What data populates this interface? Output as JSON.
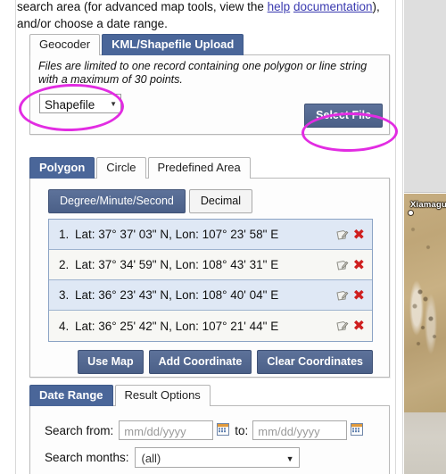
{
  "intro": {
    "line1_pre": "search area (for advanced map tools, view the ",
    "help_link": "help",
    "doc_link": "documentation",
    "line2_post": "), and/or choose a date range."
  },
  "upload_section": {
    "tabs": [
      {
        "label": "Geocoder",
        "active": false
      },
      {
        "label": "KML/Shapefile Upload",
        "active": true
      }
    ],
    "note": "Files are limited to one record containing one polygon or line string with a maximum of 30 points.",
    "file_type_value": "Shapefile",
    "file_type_caret": "▼",
    "select_file_label": "Select File"
  },
  "area_section": {
    "tabs": [
      {
        "label": "Polygon",
        "active": true
      },
      {
        "label": "Circle",
        "active": false
      },
      {
        "label": "Predefined Area",
        "active": false
      }
    ],
    "unit_toggle": [
      {
        "label": "Degree/Minute/Second",
        "active": true
      },
      {
        "label": "Decimal",
        "active": false
      }
    ],
    "coordinates": [
      {
        "num": "1.",
        "text": "Lat: 37° 37' 03\" N, Lon: 107° 23' 58\" E"
      },
      {
        "num": "2.",
        "text": "Lat: 37° 34' 59\" N, Lon: 108° 43' 31\" E"
      },
      {
        "num": "3.",
        "text": "Lat: 36° 23' 43\" N, Lon: 108° 40' 04\" E"
      },
      {
        "num": "4.",
        "text": "Lat: 36° 25' 42\" N, Lon: 107° 21' 44\" E"
      }
    ],
    "row_delete_glyph": "✖",
    "actions": [
      {
        "label": "Use Map"
      },
      {
        "label": "Add Coordinate"
      },
      {
        "label": "Clear Coordinates"
      }
    ]
  },
  "date_section": {
    "tabs": [
      {
        "label": "Date Range",
        "active": true
      },
      {
        "label": "Result Options",
        "active": false
      }
    ],
    "search_from_label": "Search from:",
    "date_from_placeholder": "mm/dd/yyyy",
    "to_label": "to:",
    "date_to_placeholder": "mm/dd/yyyy",
    "search_months_label": "Search months:",
    "months_value": "(all)",
    "months_caret": "▼"
  },
  "map": {
    "place_label": "Xiamagu"
  },
  "colors": {
    "accent_blue": "#53688f",
    "tab_active_blue": "#4a6699",
    "annotation_magenta": "#e22ce2",
    "link_blue": "#3a3ab0",
    "delete_red": "#cf1f1f",
    "row_odd": "#dfe8f5",
    "row_even": "#f7f7f4"
  }
}
